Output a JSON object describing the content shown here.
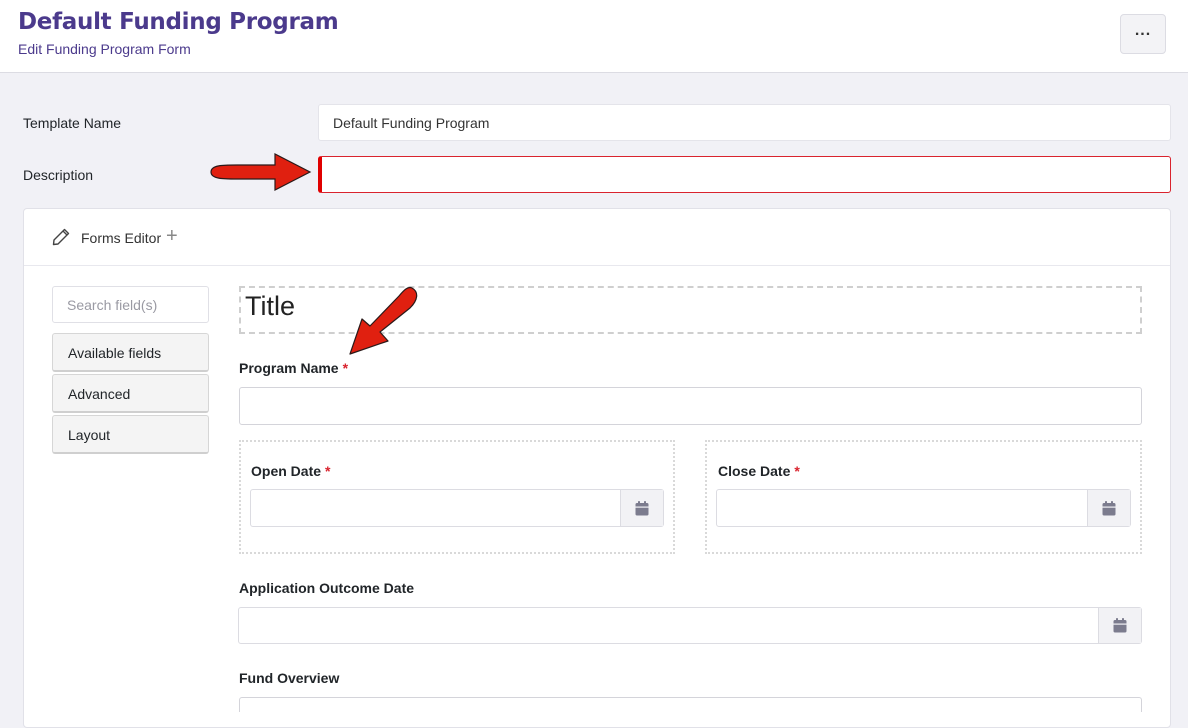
{
  "header": {
    "title": "Default Funding Program",
    "subtitle": "Edit Funding Program Form",
    "more_button": "..."
  },
  "template_form": {
    "template_name_label": "Template Name",
    "template_name_value": "Default Funding Program",
    "description_label": "Description",
    "description_value": ""
  },
  "forms_editor": {
    "title": "Forms Editor",
    "add_icon": "+",
    "search_placeholder": "Search field(s)",
    "sidebar_buttons": [
      "Available fields",
      "Advanced",
      "Layout"
    ],
    "canvas": {
      "title_component": "Title",
      "program_name_label": "Program Name",
      "open_date_label": "Open Date",
      "close_date_label": "Close Date",
      "application_outcome_label": "Application Outcome Date",
      "fund_overview_label": "Fund Overview",
      "required_marker": "*"
    }
  },
  "icons": {
    "pencil": "pencil-icon",
    "calendar": "calendar-icon",
    "plus": "plus-icon",
    "more": "more-horizontal-icon"
  },
  "colors": {
    "brand": "#4b3a8c",
    "required": "#d9232e",
    "annotation_arrow": "#e02010"
  }
}
